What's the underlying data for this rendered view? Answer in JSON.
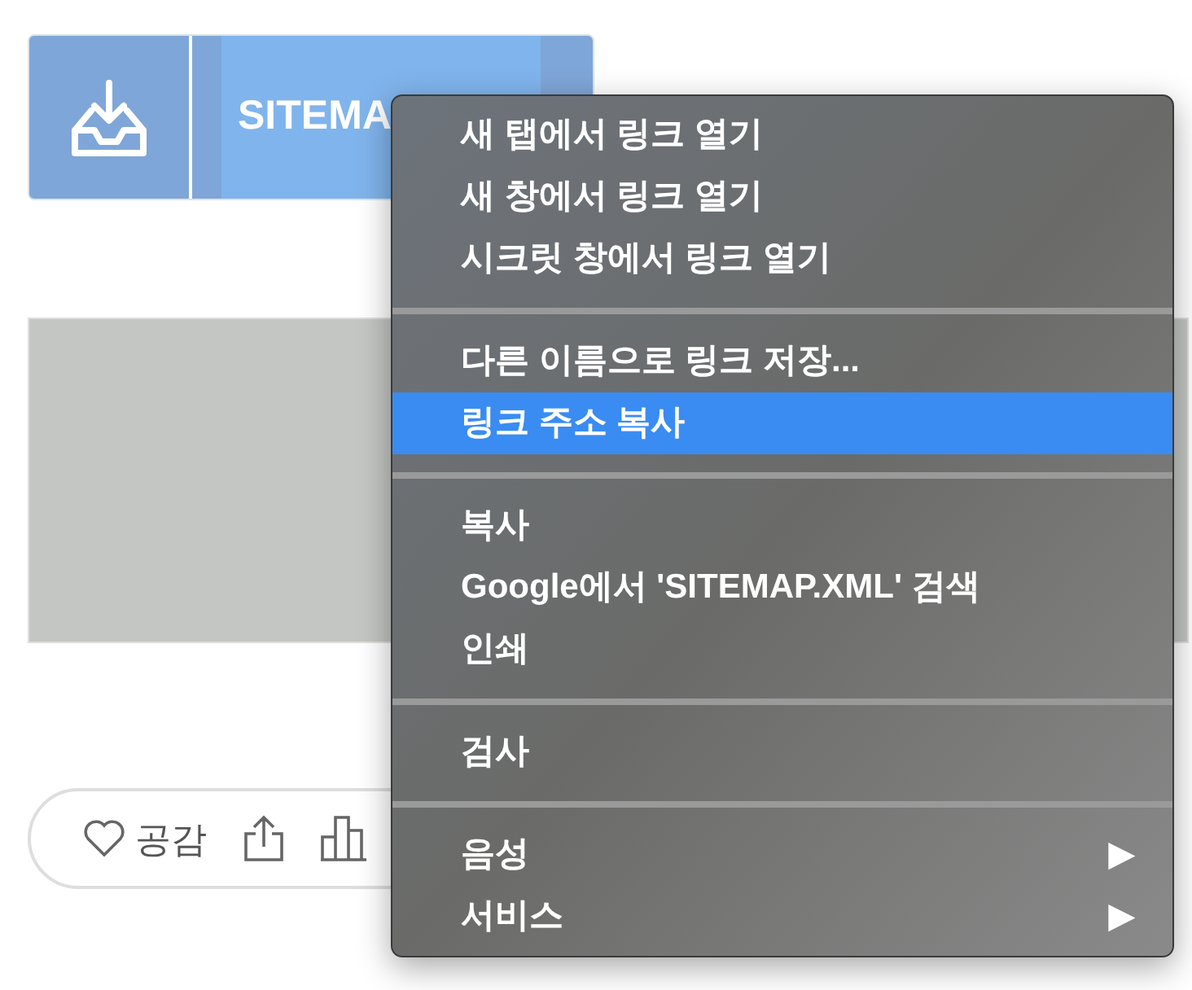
{
  "download_button": {
    "label": "SITEMA"
  },
  "reaction_bar": {
    "like_label": "공감"
  },
  "context_menu": {
    "items": [
      {
        "kind": "item",
        "label": "새 탭에서 링크 열기",
        "selected": false
      },
      {
        "kind": "item",
        "label": "새 창에서 링크 열기",
        "selected": false
      },
      {
        "kind": "item",
        "label": "시크릿 창에서 링크 열기",
        "selected": false
      },
      {
        "kind": "separator"
      },
      {
        "kind": "item",
        "label": "다른 이름으로 링크 저장...",
        "selected": false
      },
      {
        "kind": "item",
        "label": "링크 주소 복사",
        "selected": true
      },
      {
        "kind": "separator"
      },
      {
        "kind": "item",
        "label": "복사",
        "selected": false
      },
      {
        "kind": "item",
        "label": "Google에서 'SITEMAP.XML' 검색",
        "selected": false
      },
      {
        "kind": "item",
        "label": "인쇄",
        "selected": false
      },
      {
        "kind": "separator"
      },
      {
        "kind": "item",
        "label": "검사",
        "selected": false
      },
      {
        "kind": "separator"
      },
      {
        "kind": "item",
        "label": "음성",
        "selected": false,
        "arrow": "▶"
      },
      {
        "kind": "item",
        "label": "서비스",
        "selected": false,
        "arrow": "▶"
      }
    ]
  }
}
